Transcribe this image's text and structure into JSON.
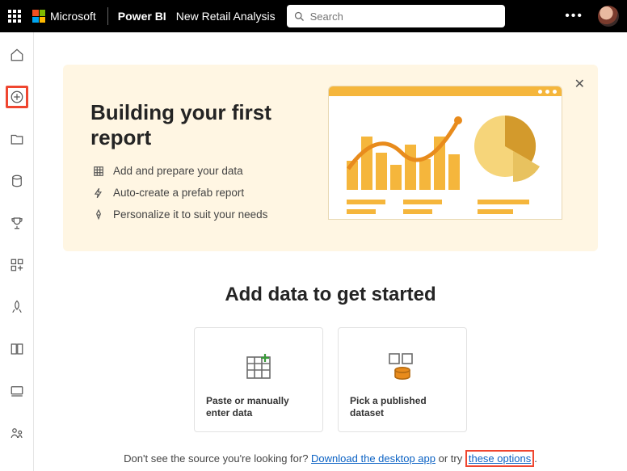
{
  "top": {
    "brand": "Microsoft",
    "product": "Power BI",
    "workspace": "New Retail Analysis",
    "search_placeholder": "Search"
  },
  "hero": {
    "title": "Building your first report",
    "steps": [
      "Add and prepare your data",
      "Auto-create a prefab report",
      "Personalize it to suit your needs"
    ]
  },
  "section_title": "Add data to get started",
  "cards": {
    "paste": "Paste or manually enter data",
    "dataset": "Pick a published dataset"
  },
  "footer": {
    "lead": "Don't see the source you're looking for? ",
    "link1": "Download the desktop app",
    "mid": " or try ",
    "link2": "these options",
    "tail": "."
  }
}
